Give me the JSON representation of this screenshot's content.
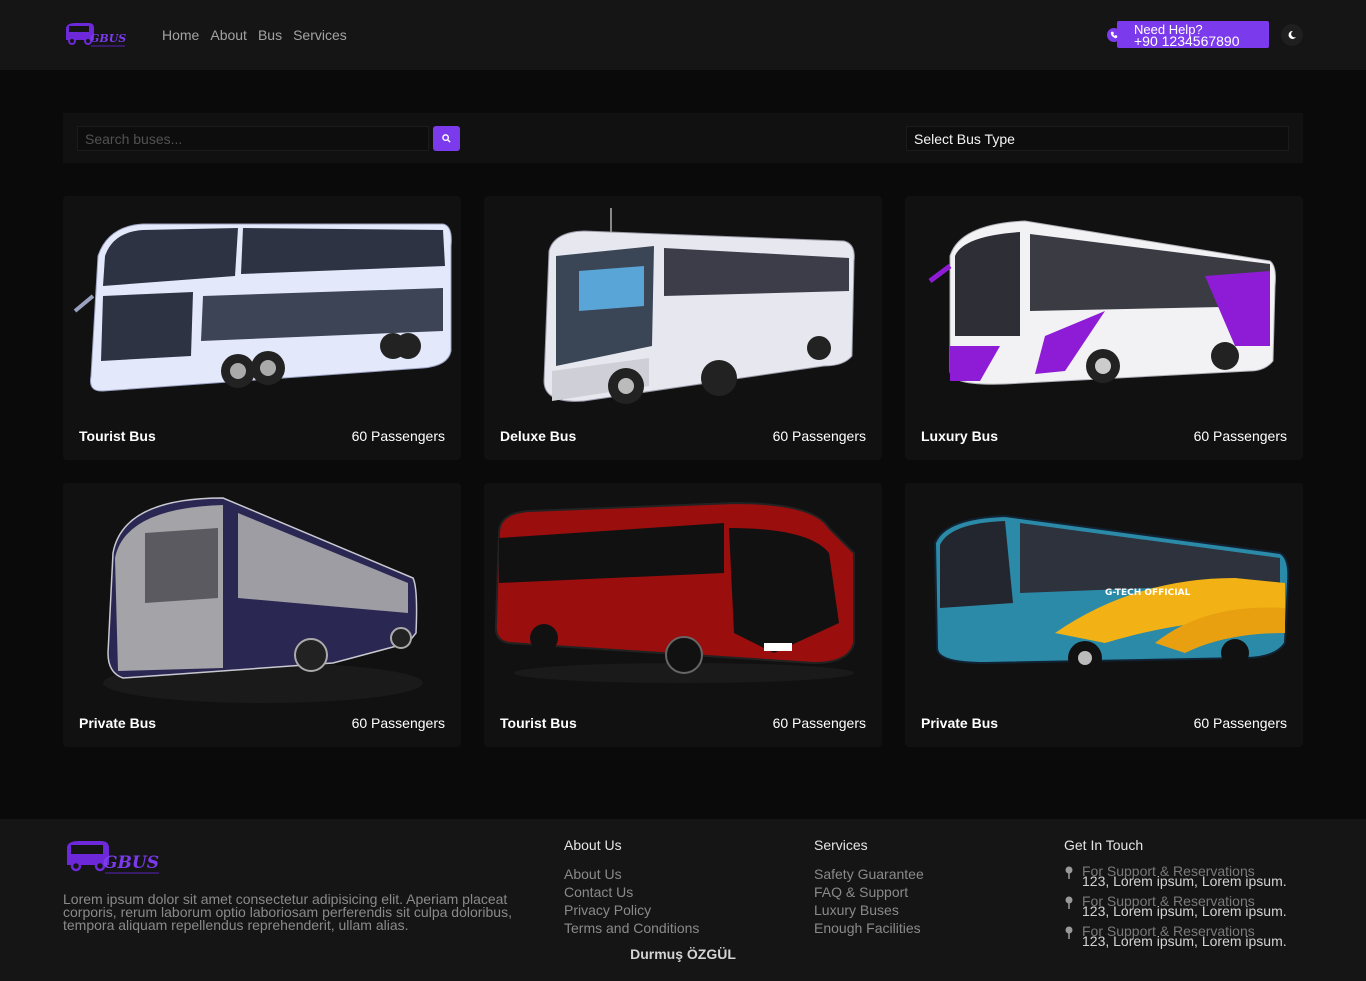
{
  "header": {
    "logo_text": "GBUS",
    "nav": [
      "Home",
      "About",
      "Bus",
      "Services"
    ],
    "help_line1": "Need Help?",
    "help_line2": "+90 1234567890",
    "theme_icon": "moon-icon",
    "accent": "#7c3aed"
  },
  "search": {
    "placeholder": "Search buses...",
    "value": "",
    "button_icon": "search-icon",
    "select_label": "Select Bus Type"
  },
  "buses": [
    {
      "name": "Tourist Bus",
      "passengers": "60 Passengers",
      "color": "#e4e8fb"
    },
    {
      "name": "Deluxe Bus",
      "passengers": "60 Passengers",
      "color": "#e7e7ef"
    },
    {
      "name": "Luxury Bus",
      "passengers": "60 Passengers",
      "color": "#f2f2f4"
    },
    {
      "name": "Private Bus",
      "passengers": "60 Passengers",
      "color": "#2a2852"
    },
    {
      "name": "Tourist Bus",
      "passengers": "60 Passengers",
      "color": "#9b0e0e"
    },
    {
      "name": "Private Bus",
      "passengers": "60 Passengers",
      "color": "#2a8aa8"
    }
  ],
  "footer": {
    "logo_text": "GBUS",
    "description": "Lorem ipsum dolor sit amet consectetur adipisicing elit. Aperiam placeat corporis, rerum laborum optio laboriosam perferendis sit culpa doloribus, tempora aliquam repellendus reprehenderit, ullam alias.",
    "about": {
      "title": "About Us",
      "links": [
        "About Us",
        "Contact Us",
        "Privacy Policy",
        "Terms and Conditions"
      ]
    },
    "services": {
      "title": "Services",
      "links": [
        "Safety Guarantee",
        "FAQ & Support",
        "Luxury Buses",
        "Enough Facilities"
      ]
    },
    "contact": {
      "title": "Get In Touch",
      "items": [
        {
          "label": "For Support & Reservations",
          "value": "123, Lorem ipsum, Lorem ipsum."
        },
        {
          "label": "For Support & Reservations",
          "value": "123, Lorem ipsum, Lorem ipsum."
        },
        {
          "label": "For Support & Reservations",
          "value": "123, Lorem ipsum, Lorem ipsum."
        }
      ]
    },
    "author": "Durmuş ÖZGÜL"
  }
}
